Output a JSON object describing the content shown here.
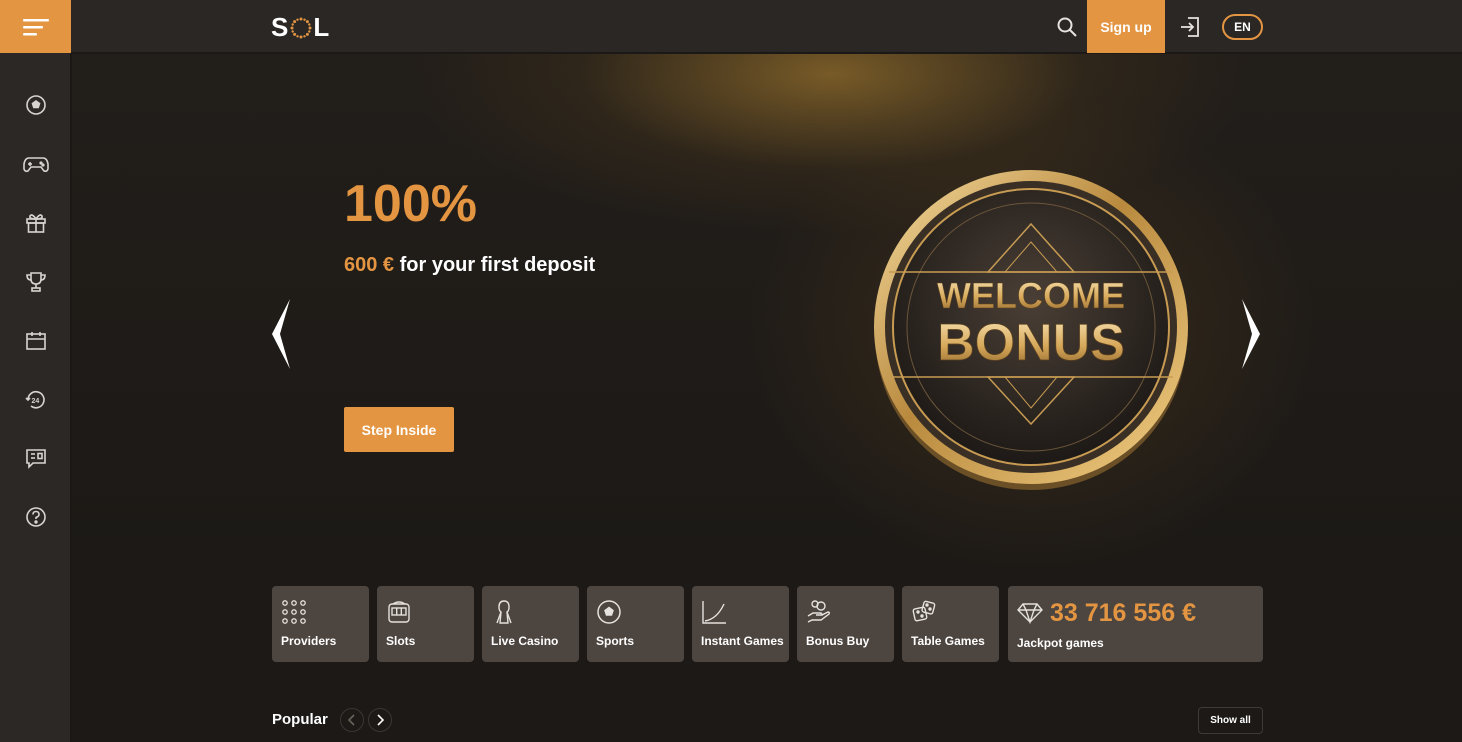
{
  "header": {
    "logo_left": "S",
    "logo_right": "L",
    "signup_label": "Sign up",
    "lang_label": "EN"
  },
  "sidebar": {
    "items": [
      {
        "icon": "soccer-ball-icon"
      },
      {
        "icon": "gamepad-icon"
      },
      {
        "icon": "gift-icon"
      },
      {
        "icon": "trophy-icon"
      },
      {
        "icon": "calendar-icon"
      },
      {
        "icon": "support-24-icon"
      },
      {
        "icon": "chat-icon"
      },
      {
        "icon": "help-icon"
      }
    ]
  },
  "hero": {
    "percent": "100%",
    "amount": "600 €",
    "subtitle": " for your first deposit",
    "cta_label": "Step Inside",
    "badge_line1": "WELCOME",
    "badge_line2": "BONUS"
  },
  "categories": [
    {
      "label": "Providers",
      "icon": "grid-dots-icon"
    },
    {
      "label": "Slots",
      "icon": "slot-machine-icon"
    },
    {
      "label": "Live Casino",
      "icon": "dealer-icon"
    },
    {
      "label": "Sports",
      "icon": "soccer-ball-icon"
    },
    {
      "label": "Instant Games",
      "icon": "chart-curve-icon"
    },
    {
      "label": "Bonus Buy",
      "icon": "hand-coins-icon"
    },
    {
      "label": "Table Games",
      "icon": "dice-icon"
    }
  ],
  "jackpot": {
    "amount": "33 716 556 €",
    "label": "Jackpot games",
    "icon": "diamond-icon"
  },
  "popular": {
    "title": "Popular",
    "show_all_label": "Show all"
  },
  "colors": {
    "accent": "#e39542",
    "tile_bg": "#4d4540",
    "sidebar_bg": "#2b2826"
  }
}
